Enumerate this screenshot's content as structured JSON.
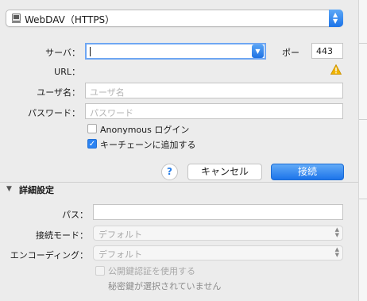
{
  "connection_type": "WebDAV（HTTPS）",
  "server": {
    "label": "サーバ：",
    "value": ""
  },
  "port": {
    "label": "ポー",
    "value": "443"
  },
  "url": {
    "label": "URL："
  },
  "username": {
    "label": "ユーザ名：",
    "placeholder": "ユーザ名"
  },
  "password": {
    "label": "パスワード：",
    "placeholder": "パスワード"
  },
  "options": {
    "anonymous": {
      "label": "Anonymous ログイン",
      "checked": false
    },
    "keychain": {
      "label": "キーチェーンに追加する",
      "checked": true
    }
  },
  "buttons": {
    "help": "?",
    "cancel": "キャンセル",
    "connect": "接続"
  },
  "advanced": {
    "title": "詳細設定",
    "path": {
      "label": "パス：",
      "value": ""
    },
    "connect_mode": {
      "label": "接続モード：",
      "value": "デフォルト"
    },
    "encoding": {
      "label": "エンコーディング：",
      "value": "デフォルト"
    },
    "public_key": {
      "label": "公開鍵認証を使用する",
      "checked": false
    },
    "private_key_status": "秘密鍵が選択されていません"
  },
  "colors": {
    "accent": "#1c74ea",
    "warning": "#f0b400"
  }
}
